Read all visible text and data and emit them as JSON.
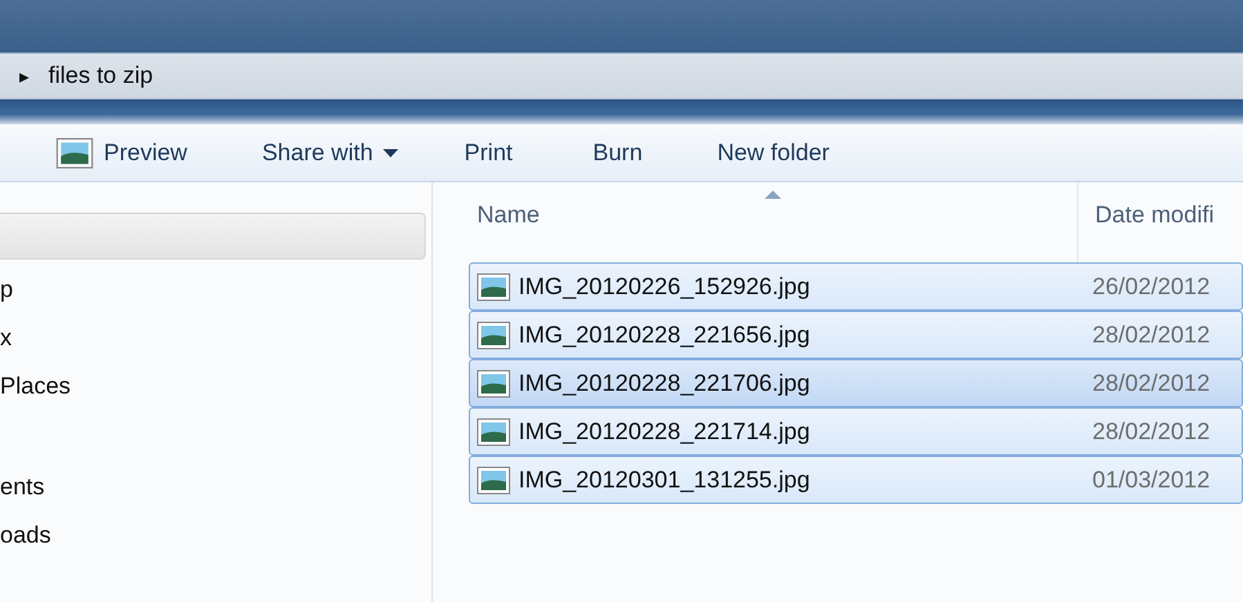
{
  "breadcrumb": {
    "arrow": "▸",
    "folder": "files to zip"
  },
  "toolbar": [
    {
      "kind": "icon",
      "label": "Preview"
    },
    {
      "kind": "menu",
      "label": "Share with"
    },
    {
      "kind": "plain",
      "label": "Print"
    },
    {
      "kind": "plain",
      "label": "Burn"
    },
    {
      "kind": "plain",
      "label": "New folder"
    }
  ],
  "nav_groups": [
    {
      "items": [
        "p",
        "x",
        "Places"
      ]
    },
    {
      "items": [
        "ents",
        "oads"
      ]
    }
  ],
  "columns": [
    {
      "label": "Name",
      "sorted": true
    },
    {
      "label": "Date modifi",
      "sorted": false
    }
  ],
  "files": [
    {
      "name": "IMG_20120226_152926.jpg",
      "date": "26/02/2012",
      "selected": true,
      "hovered": false
    },
    {
      "name": "IMG_20120228_221656.jpg",
      "date": "28/02/2012",
      "selected": true,
      "hovered": false
    },
    {
      "name": "IMG_20120228_221706.jpg",
      "date": "28/02/2012",
      "selected": true,
      "hovered": true
    },
    {
      "name": "IMG_20120228_221714.jpg",
      "date": "28/02/2012",
      "selected": true,
      "hovered": false
    },
    {
      "name": "IMG_20120301_131255.jpg",
      "date": "01/03/2012",
      "selected": true,
      "hovered": false
    }
  ]
}
